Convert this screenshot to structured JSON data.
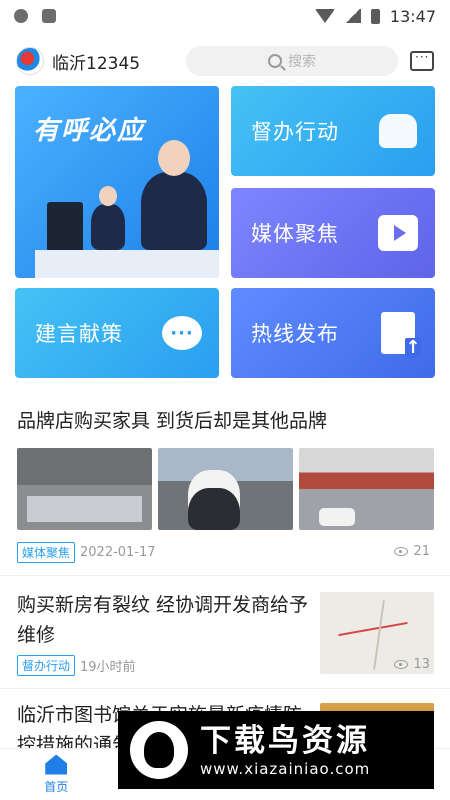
{
  "status_bar": {
    "time": "13:47"
  },
  "header": {
    "app_title": "临沂12345",
    "search_placeholder": "搜索"
  },
  "tiles": {
    "hero_title": "有呼必应",
    "duban": "督办行动",
    "media": "媒体聚焦",
    "jianyan": "建言献策",
    "hotline": "热线发布"
  },
  "news": [
    {
      "title": "品牌店购买家具  到货后却是其他品牌",
      "tag": "媒体聚焦",
      "time": "2022-01-17",
      "views": "21"
    },
    {
      "title": "购买新房有裂纹  经协调开发商给予维修",
      "tag": "督办行动",
      "time": "19小时前",
      "views": "13"
    },
    {
      "title": "临沂市图书馆关于实施最新疫情防控措施的通告"
    }
  ],
  "bottom_nav": {
    "home": "首页"
  },
  "watermark": {
    "text": "下载鸟资源",
    "url": "www.xiazainiao.com"
  },
  "colors": {
    "accent": "#1f7fe6",
    "tag": "#2a9ef0"
  }
}
